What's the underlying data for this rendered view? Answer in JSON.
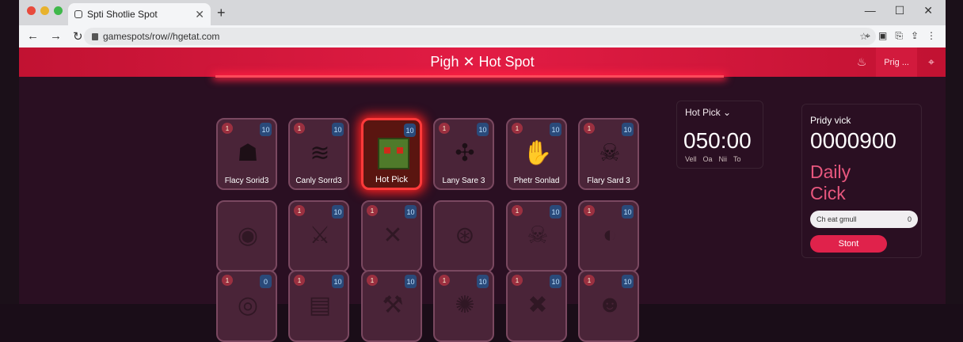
{
  "browser": {
    "tab_title": "Spti Shotlie Spot",
    "url": "gamespots/row//hgetat.com",
    "new_tab": "+",
    "nav": [
      "←",
      "→",
      "↻"
    ],
    "tools": [
      "⌖",
      "▣",
      "⎘",
      "⇪",
      "⋮"
    ],
    "window_controls": [
      "—",
      "☐",
      "✕"
    ]
  },
  "header": {
    "title": "Pigh ✕ Hot Spot",
    "right_btn": "Prig ..."
  },
  "timer": {
    "label": "Hot Pick ⌄",
    "value": "050:00",
    "units": [
      "Vell",
      "Oa",
      "Nii",
      "To"
    ]
  },
  "promo": {
    "label": "Pridy vick",
    "value": "0000900",
    "heading_line1": "Daily",
    "heading_line2": "Cick",
    "input_value": "Ch eat gmull",
    "input_suffix": "0",
    "button": "Stont"
  },
  "cards": [
    {
      "label": "Flacy Sorid3",
      "rank": "1",
      "num": "10",
      "icon": "hooded-figure-icon"
    },
    {
      "label": "Canly Sorrd3",
      "rank": "1",
      "num": "10",
      "icon": "wing-emblem-icon"
    },
    {
      "label": "Hot Pick",
      "rank": "",
      "num": "10",
      "icon": "cube-creature-icon",
      "hot": true
    },
    {
      "label": "Lany Sare 3",
      "rank": "1",
      "num": "10",
      "icon": "spider-creature-icon"
    },
    {
      "label": "Phetr Sonlad",
      "rank": "1",
      "num": "10",
      "icon": "hand-monster-icon"
    },
    {
      "label": "Flary Sard 3",
      "rank": "1",
      "num": "10",
      "icon": "skull-mask-icon"
    },
    {
      "label": "",
      "rank": "",
      "num": "",
      "icon": "shield-crest-icon"
    },
    {
      "label": "",
      "rank": "1",
      "num": "10",
      "icon": "crossed-blades-icon"
    },
    {
      "label": "",
      "rank": "1",
      "num": "10",
      "icon": "cross-swords-icon"
    },
    {
      "label": "",
      "rank": "",
      "num": "",
      "icon": "round-emblem-icon"
    },
    {
      "label": "",
      "rank": "1",
      "num": "10",
      "icon": "skull-crossbones-icon"
    },
    {
      "label": "",
      "rank": "1",
      "num": "10",
      "icon": "eye-orb-icon"
    },
    {
      "label": "",
      "rank": "1",
      "num": "0",
      "icon": "spiral-shield-icon"
    },
    {
      "label": "",
      "rank": "1",
      "num": "10",
      "icon": "treasure-chest-icon"
    },
    {
      "label": "",
      "rank": "1",
      "num": "10",
      "icon": "hammer-rune-icon"
    },
    {
      "label": "",
      "rank": "1",
      "num": "10",
      "icon": "skull-badge-icon"
    },
    {
      "label": "",
      "rank": "1",
      "num": "10",
      "icon": "crossed-bones-icon"
    },
    {
      "label": "",
      "rank": "1",
      "num": "10",
      "icon": "hooded-face-icon"
    }
  ],
  "colors": {
    "accent": "#e21c44",
    "page_bg": "#2a0f22",
    "hot_glow": "#ff2020"
  }
}
